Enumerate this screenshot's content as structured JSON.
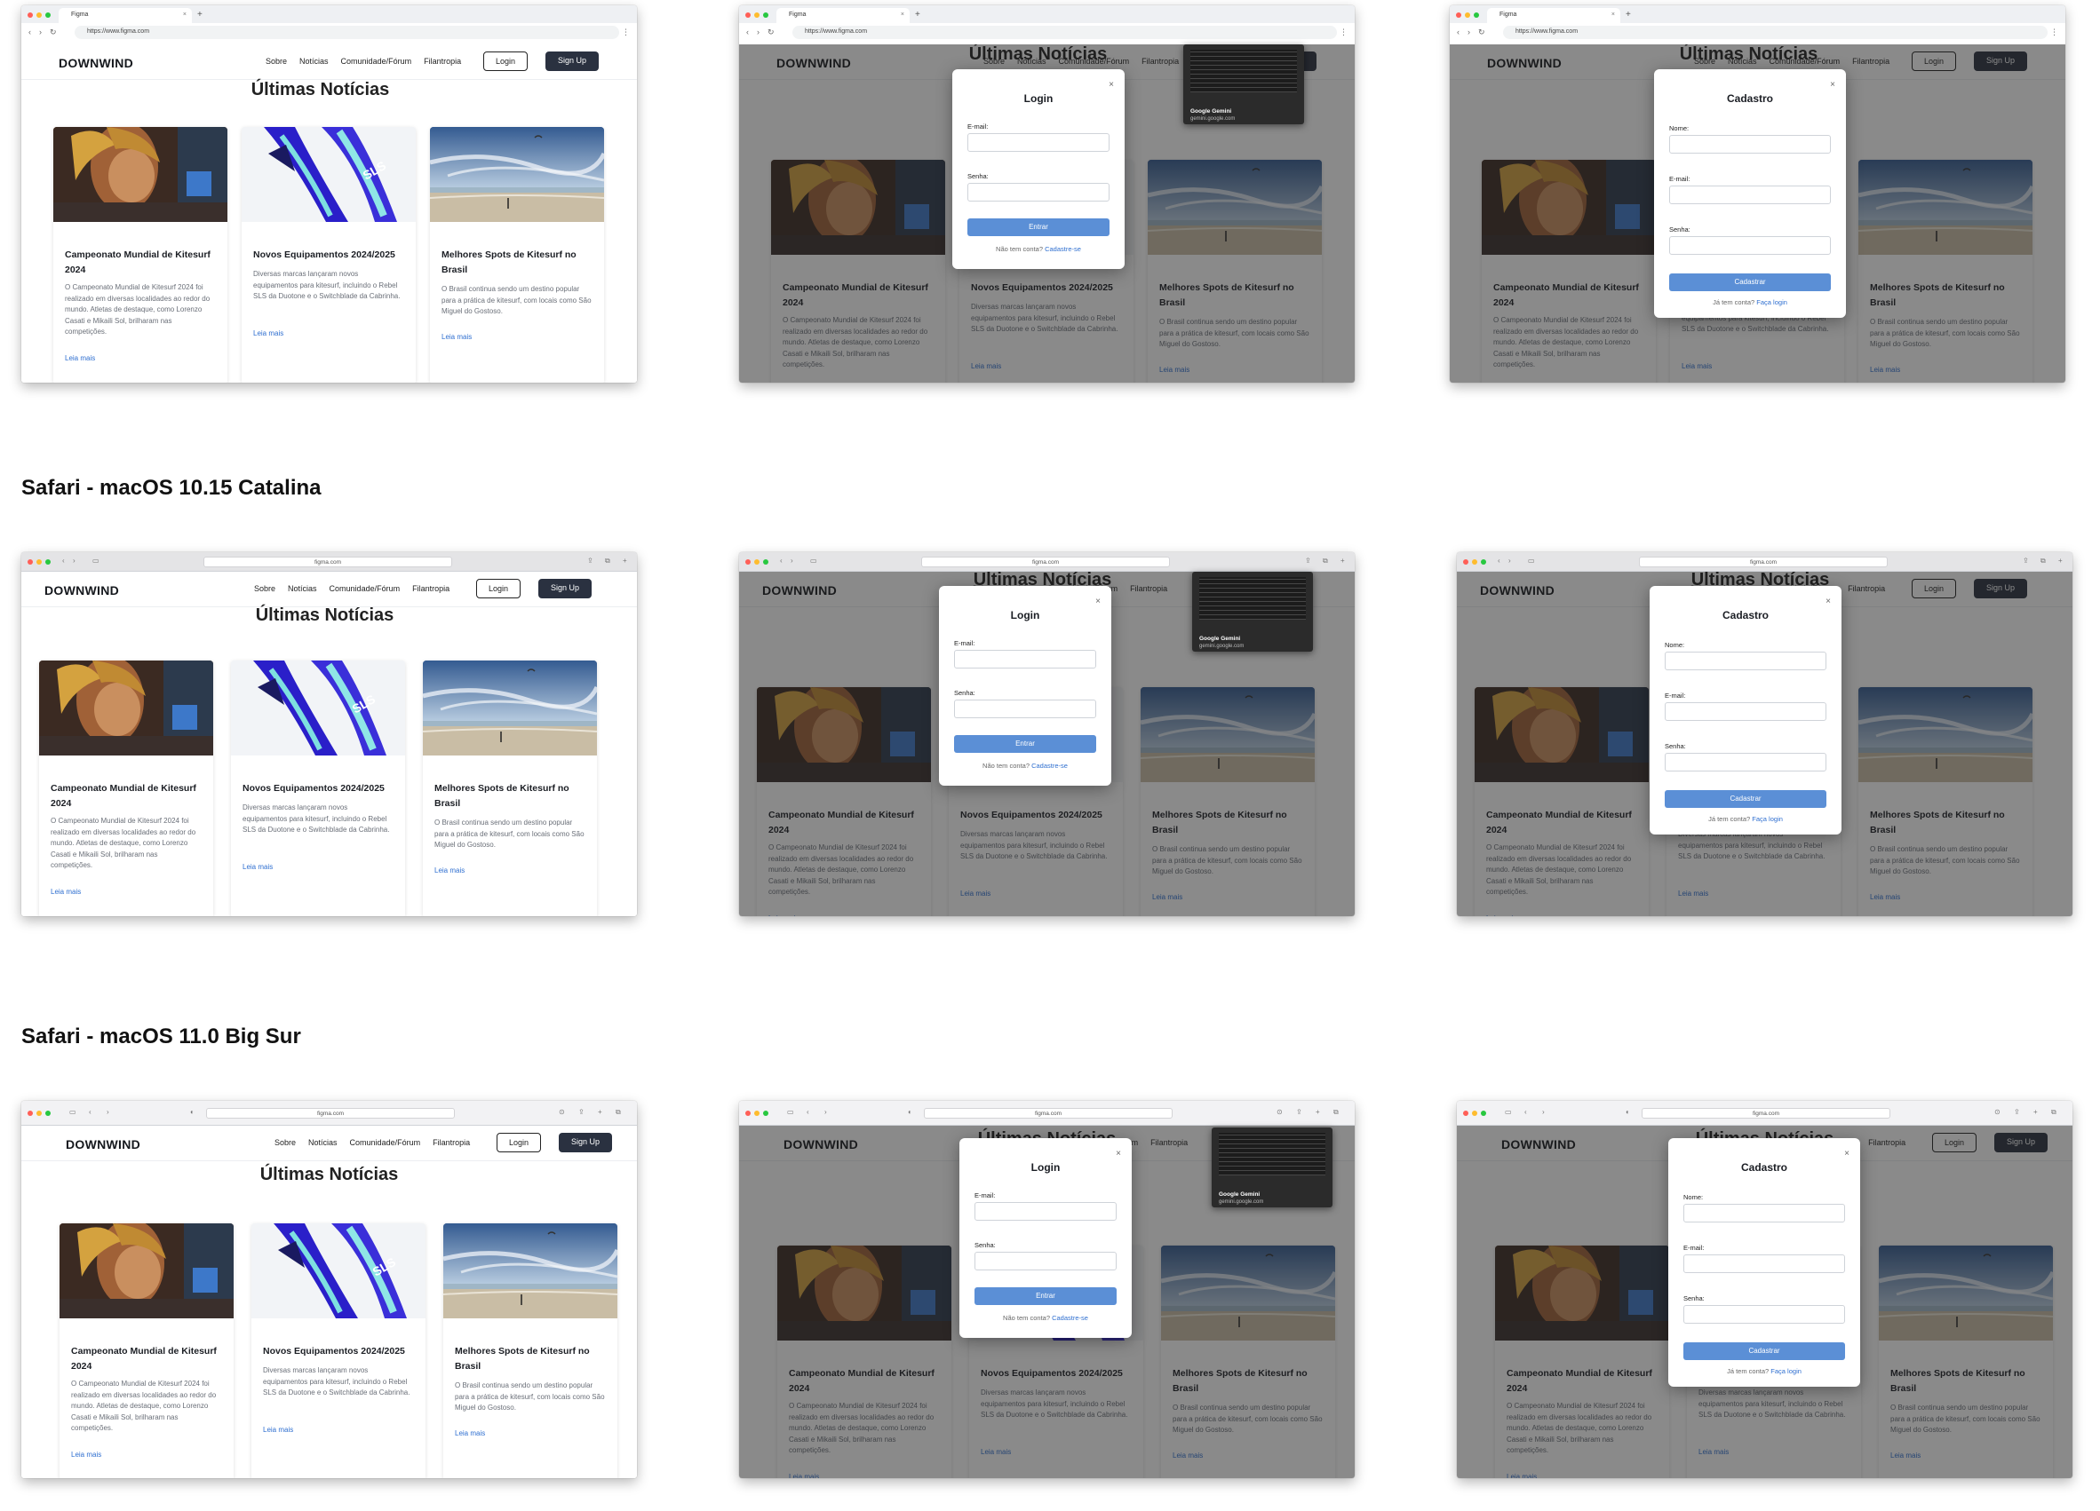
{
  "sections": [
    {
      "title": ""
    },
    {
      "title": "Safari - macOS 10.15 Catalina"
    },
    {
      "title": "Safari - macOS 11.0 Big Sur"
    }
  ],
  "browser": {
    "chrome_tab_title": "Figma",
    "chrome_url": "https://www.figma.com",
    "safari_url": "figma.com"
  },
  "site": {
    "logo": "DOWNWIND",
    "nav": [
      "Sobre",
      "Notícias",
      "Comunidade/Fórum",
      "Filantropia"
    ],
    "login_label": "Login",
    "signup_label": "Sign Up",
    "heading": "Últimas Notícias",
    "cards": [
      {
        "image": "kitesurfer-portrait",
        "title": "Campeonato Mundial de Kitesurf 2024",
        "text": "O Campeonato Mundial de Kitesurf 2024 foi realizado em diversas localidades ao redor do mundo. Atletas de destaque, como Lorenzo Casati e Mikaili Sol, brilharam nas competições.",
        "link": "Leia mais"
      },
      {
        "image": "blue-kites",
        "title": "Novos Equipamentos 2024/2025",
        "text": "Diversas marcas lançaram novos equipamentos para kitesurf, incluindo o Rebel SLS da Duotone e o Switchblade da Cabrinha.",
        "link": "Leia mais"
      },
      {
        "image": "beach-sky",
        "title": "Melhores Spots de Kitesurf no Brasil",
        "text": "O Brasil continua sendo um destino popular para a prática de kitesurf, com locais como São Miguel do Gostoso.",
        "link": "Leia mais"
      }
    ]
  },
  "login_modal": {
    "title": "Login",
    "close": "×",
    "email_label": "E-mail:",
    "password_label": "Senha:",
    "submit": "Entrar",
    "footer_text": "Não tem conta?",
    "footer_link": "Cadastre-se"
  },
  "signup_modal": {
    "title": "Cadastro",
    "close": "×",
    "name_label": "Nome:",
    "email_label": "E-mail:",
    "password_label": "Senha:",
    "submit": "Cadastrar",
    "footer_text": "Já tem conta?",
    "footer_link": "Faça login"
  },
  "gemini_popup": {
    "title": "Google Gemini",
    "url": "gemini.google.com"
  },
  "colors": {
    "accent": "#5b8fd6",
    "link": "#2f6fd0",
    "signup_bg": "#2a3140",
    "overlay": "rgba(30,30,30,0.52)"
  }
}
